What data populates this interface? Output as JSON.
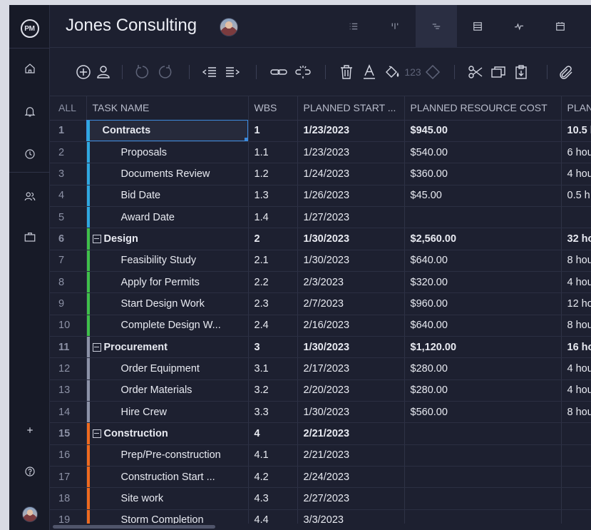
{
  "app": {
    "logo_text": "PM",
    "project_title": "Jones Consulting"
  },
  "sidebar": {
    "items": [
      {
        "name": "home-icon"
      },
      {
        "name": "bell-icon"
      },
      {
        "name": "clock-icon"
      },
      {
        "name": "team-icon"
      },
      {
        "name": "briefcase-icon"
      },
      {
        "name": "plus-icon"
      },
      {
        "name": "help-icon"
      }
    ]
  },
  "views": [
    {
      "name": "list-view-icon"
    },
    {
      "name": "board-view-icon"
    },
    {
      "name": "gantt-view-icon",
      "active": true
    },
    {
      "name": "sheet-view-icon"
    },
    {
      "name": "dashboard-view-icon"
    },
    {
      "name": "calendar-view-icon"
    }
  ],
  "toolbar": {
    "format_number_label": "123"
  },
  "grid": {
    "columns": [
      "ALL",
      "TASK NAME",
      "WBS",
      "PLANNED START ...",
      "PLANNED RESOURCE COST",
      "PLAN"
    ],
    "rows": [
      {
        "num": "1",
        "name": "Contracts",
        "wbs": "1",
        "start": "1/23/2023",
        "cost": "$945.00",
        "hours": "10.5 h",
        "level": 0,
        "parent": true,
        "color": "#2fa8e0",
        "collapsible": false,
        "selected": true
      },
      {
        "num": "2",
        "name": "Proposals",
        "wbs": "1.1",
        "start": "1/23/2023",
        "cost": "$540.00",
        "hours": "6 hou",
        "level": 1,
        "parent": false,
        "color": "#2fa8e0"
      },
      {
        "num": "3",
        "name": "Documents Review",
        "wbs": "1.2",
        "start": "1/24/2023",
        "cost": "$360.00",
        "hours": "4 hou",
        "level": 1,
        "parent": false,
        "color": "#2fa8e0"
      },
      {
        "num": "4",
        "name": "Bid Date",
        "wbs": "1.3",
        "start": "1/26/2023",
        "cost": "$45.00",
        "hours": "0.5 h",
        "level": 1,
        "parent": false,
        "color": "#2fa8e0"
      },
      {
        "num": "5",
        "name": "Award Date",
        "wbs": "1.4",
        "start": "1/27/2023",
        "cost": "",
        "hours": "",
        "level": 1,
        "parent": false,
        "color": "#2fa8e0"
      },
      {
        "num": "6",
        "name": "Design",
        "wbs": "2",
        "start": "1/30/2023",
        "cost": "$2,560.00",
        "hours": "32 ho",
        "level": 0,
        "parent": true,
        "color": "#3fbf4a",
        "collapsible": true
      },
      {
        "num": "7",
        "name": "Feasibility Study",
        "wbs": "2.1",
        "start": "1/30/2023",
        "cost": "$640.00",
        "hours": "8 hou",
        "level": 1,
        "parent": false,
        "color": "#3fbf4a"
      },
      {
        "num": "8",
        "name": "Apply for Permits",
        "wbs": "2.2",
        "start": "2/3/2023",
        "cost": "$320.00",
        "hours": "4 hou",
        "level": 1,
        "parent": false,
        "color": "#3fbf4a"
      },
      {
        "num": "9",
        "name": "Start Design Work",
        "wbs": "2.3",
        "start": "2/7/2023",
        "cost": "$960.00",
        "hours": "12 ho",
        "level": 1,
        "parent": false,
        "color": "#3fbf4a"
      },
      {
        "num": "10",
        "name": "Complete Design W...",
        "wbs": "2.4",
        "start": "2/16/2023",
        "cost": "$640.00",
        "hours": "8 hou",
        "level": 1,
        "parent": false,
        "color": "#3fbf4a"
      },
      {
        "num": "11",
        "name": "Procurement",
        "wbs": "3",
        "start": "1/30/2023",
        "cost": "$1,120.00",
        "hours": "16 ho",
        "level": 0,
        "parent": true,
        "color": "#8d93a8",
        "collapsible": true
      },
      {
        "num": "12",
        "name": "Order Equipment",
        "wbs": "3.1",
        "start": "2/17/2023",
        "cost": "$280.00",
        "hours": "4 hou",
        "level": 1,
        "parent": false,
        "color": "#8d93a8"
      },
      {
        "num": "13",
        "name": "Order Materials",
        "wbs": "3.2",
        "start": "2/20/2023",
        "cost": "$280.00",
        "hours": "4 hou",
        "level": 1,
        "parent": false,
        "color": "#8d93a8"
      },
      {
        "num": "14",
        "name": "Hire Crew",
        "wbs": "3.3",
        "start": "1/30/2023",
        "cost": "$560.00",
        "hours": "8 hou",
        "level": 1,
        "parent": false,
        "color": "#8d93a8"
      },
      {
        "num": "15",
        "name": "Construction",
        "wbs": "4",
        "start": "2/21/2023",
        "cost": "",
        "hours": "",
        "level": 0,
        "parent": true,
        "color": "#ee6a1f",
        "collapsible": true
      },
      {
        "num": "16",
        "name": "Prep/Pre-construction",
        "wbs": "4.1",
        "start": "2/21/2023",
        "cost": "",
        "hours": "",
        "level": 1,
        "parent": false,
        "color": "#ee6a1f"
      },
      {
        "num": "17",
        "name": "Construction Start ...",
        "wbs": "4.2",
        "start": "2/24/2023",
        "cost": "",
        "hours": "",
        "level": 1,
        "parent": false,
        "color": "#ee6a1f"
      },
      {
        "num": "18",
        "name": "Site work",
        "wbs": "4.3",
        "start": "2/27/2023",
        "cost": "",
        "hours": "",
        "level": 1,
        "parent": false,
        "color": "#ee6a1f"
      },
      {
        "num": "19",
        "name": "Storm Completion",
        "wbs": "4.4",
        "start": "3/3/2023",
        "cost": "",
        "hours": "",
        "level": 1,
        "parent": false,
        "color": "#ee6a1f"
      }
    ]
  }
}
